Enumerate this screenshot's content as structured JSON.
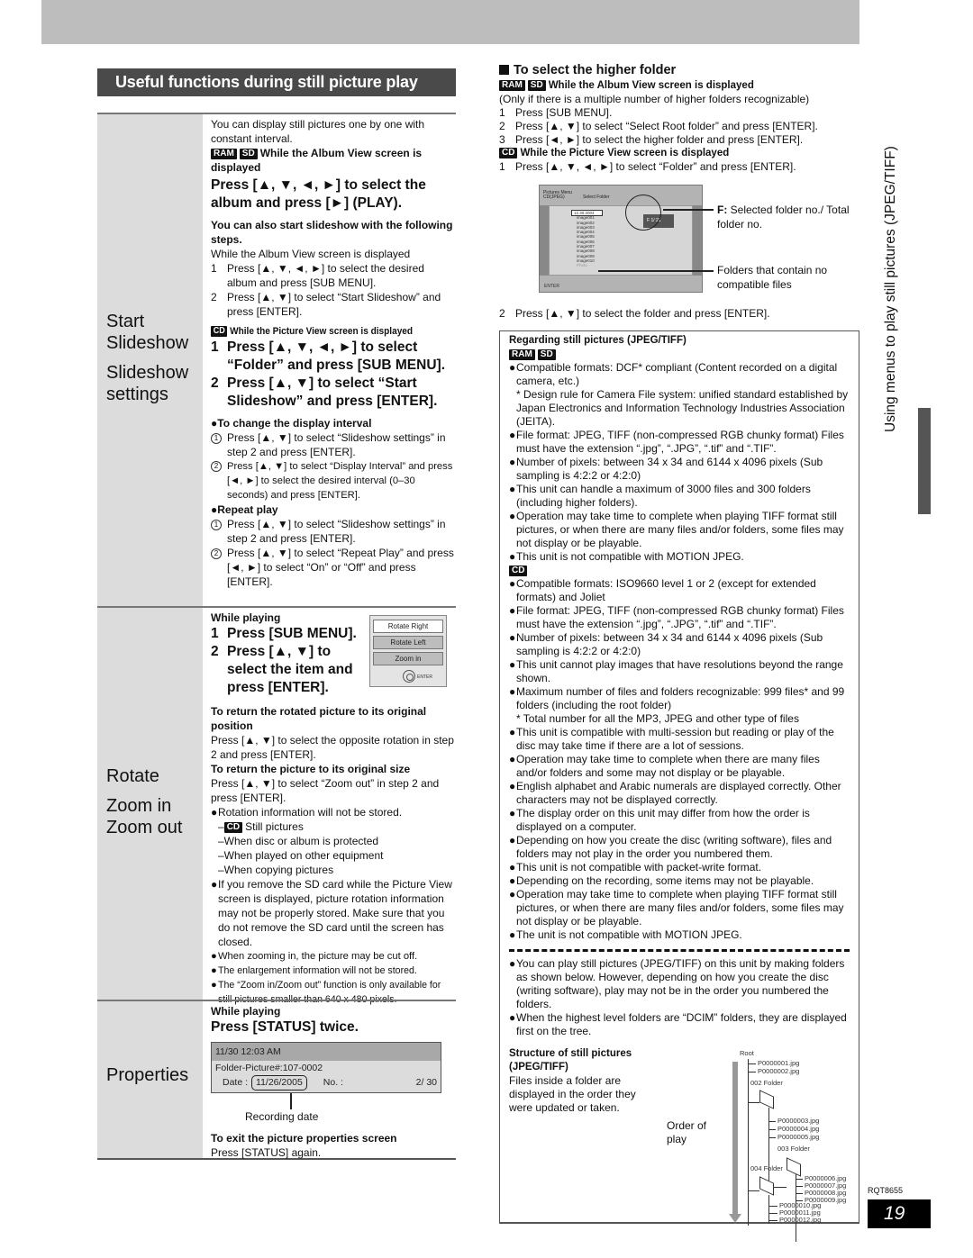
{
  "page": {
    "model_code": "RQT8655",
    "page_number": "19",
    "side_tab": "Using menus to play still pictures (JPEG/TIFF)"
  },
  "section_title": "Useful functions during still picture play",
  "badges": {
    "ram": "RAM",
    "sd": "SD",
    "cd": "CD"
  },
  "slideshow": {
    "labels": [
      "Start",
      "Slideshow",
      "Slideshow",
      "settings"
    ],
    "intro": "You can display still pictures one by one with constant interval.",
    "ramsd_cond": "While the Album View screen is displayed",
    "main_step": "Press [▲, ▼, ◄, ►] to select the album and press [►] (PLAY).",
    "also_title": "You can also start slideshow with the following steps.",
    "also_cond": "While the Album View screen is displayed",
    "also_steps": [
      "Press [▲, ▼, ◄, ►] to select the desired album and press [SUB MENU].",
      "Press [▲, ▼] to select “Start Slideshow” and press [ENTER]."
    ],
    "cd_cond": "While the Picture View screen is displayed",
    "cd_steps": [
      "Press [▲, ▼, ◄, ►] to select “Folder” and press [SUB MENU].",
      "Press [▲, ▼] to select “Start Slideshow” and press [ENTER]."
    ],
    "interval_title": "●To change the display interval",
    "interval_steps": [
      "Press [▲, ▼] to select “Slideshow settings” in step 2 and press [ENTER].",
      "Press [▲, ▼] to select “Display Interval” and press [◄, ►] to select the desired interval (0–30 seconds) and press [ENTER]."
    ],
    "repeat_title": "●Repeat play",
    "repeat_steps": [
      "Press [▲, ▼] to select “Slideshow settings” in step 2 and press [ENTER].",
      "Press [▲, ▼] to select “Repeat Play” and press [◄, ►] to select “On” or “Off” and press [ENTER]."
    ]
  },
  "rotate": {
    "labels": [
      "Rotate",
      "Zoom in",
      "Zoom out"
    ],
    "while_playing": "While playing",
    "steps": [
      "Press [SUB MENU].",
      "Press [▲, ▼] to select the item and press [ENTER]."
    ],
    "submenu": [
      "Rotate Right",
      "Rotate Left",
      "Zoom in"
    ],
    "submenu_enter": "ENTER",
    "return_rot_title": "To return the rotated picture to its original position",
    "return_rot_text": "Press [▲, ▼] to select the opposite rotation in step 2 and press [ENTER].",
    "return_size_title": "To return the picture to its original size",
    "return_size_text": "Press [▲, ▼] to select “Zoom out” in step 2 and press [ENTER].",
    "note_rotation": "Rotation information will not be stored.",
    "note_cd_still": "Still pictures",
    "note_dashes": [
      "–When disc or album is protected",
      "–When played on other equipment",
      "–When copying pictures"
    ],
    "note_sd": "If you remove the SD card while the Picture View screen is displayed, picture rotation information may not be properly stored. Make sure that you do not remove the SD card until the screen has closed.",
    "note_cut": "When zooming in, the picture may be cut off.",
    "note_enlarge": "The enlargement information will not be stored.",
    "note_zoom": "The “Zoom in/Zoom out” function is only available for still pictures smaller than 640 x 480 pixels."
  },
  "properties": {
    "label": "Properties",
    "while_playing": "While playing",
    "step": "Press [STATUS] twice.",
    "screen_top": "11/30  12:03 AM",
    "screen_folder": "Folder-Picture#:107-0002",
    "date_label": "Date :",
    "date_value": "11/26/2005",
    "no_label": "No. :",
    "no_value": "2/  30",
    "callout": "Recording date",
    "exit_title": "To exit the picture properties screen",
    "exit_text": "Press [STATUS] again."
  },
  "higher_folder": {
    "title": "To select the higher folder",
    "ramsd_cond": "While the Album View screen is displayed",
    "note": "(Only if there is a multiple number of higher folders recognizable)",
    "steps": [
      "Press [SUB MENU].",
      "Press [▲, ▼] to select “Select Root folder” and press [ENTER].",
      "Press [◄, ►] to select the higher folder and press [ENTER]."
    ],
    "cd_cond": "While the Picture View screen is displayed",
    "cd_step1": "Press [▲, ▼, ◄, ►] to select “Folder” and press [ENTER].",
    "cd_step2": "Press [▲, ▼] to select the folder and press [ENTER].",
    "screen": {
      "menu": "Pictures Menu",
      "sub": "CD(JPEG)",
      "title": "Select Folder",
      "counter": "F     1/ 21",
      "selected": "12.30.2004",
      "folders": [
        "image001",
        "image002",
        "image003",
        "image004",
        "image005",
        "image006",
        "image007",
        "image008",
        "image009",
        "image010",
        "Photo"
      ],
      "enter": "ENTER"
    },
    "annot_f_bold": "F:",
    "annot_f": " Selected folder no./ Total folder no.",
    "annot_nocompat": "Folders that contain no compatible files"
  },
  "regarding": {
    "title": "Regarding still pictures (JPEG/TIFF)",
    "ramsd_items": [
      "Compatible formats: DCF* compliant (Content recorded on a digital camera, etc.)",
      "File format: JPEG, TIFF (non-compressed RGB chunky format) Files must have the extension “.jpg”, “.JPG”, “.tif” and “.TIF”.",
      "Number of pixels: between 34 x 34 and 6144 x 4096 pixels (Sub sampling is 4:2:2 or 4:2:0)",
      "This unit can handle a maximum of 3000 files and 300 folders (including higher folders).",
      "Operation may take time to complete when playing TIFF format still pictures, or when there are many files and/or folders, some files may not display or be playable.",
      "This unit is not compatible with MOTION JPEG."
    ],
    "dcf_note": "* Design rule for Camera File system: unified standard established by Japan Electronics and Information Technology Industries Association (JEITA).",
    "cd_items": [
      "Compatible formats: ISO9660 level 1 or 2 (except for extended formats) and Joliet",
      "File format: JPEG, TIFF (non-compressed RGB chunky format) Files must have the extension “.jpg”, “.JPG”, “.tif” and “.TIF”.",
      "Number of pixels: between 34 x 34 and 6144 x 4096 pixels (Sub sampling is 4:2:2 or 4:2:0)",
      "This unit cannot play images that have resolutions beyond the range shown.",
      "Maximum number of files and folders recognizable: 999 files* and 99 folders (including the root folder)",
      "This unit is compatible with multi-session but reading or play of the disc may take time if there are a lot of sessions.",
      "Operation may take time to complete when there are many files and/or folders and some may not display or be playable.",
      "English alphabet and Arabic numerals are displayed correctly. Other characters may not be displayed correctly.",
      "The display order on this unit may differ from how the order is displayed on a computer.",
      "Depending on how you create the disc (writing software), files and folders may not play in the order you numbered them.",
      "This unit is not compatible with packet-write format.",
      "Depending on the recording, some items may not be playable.",
      "Operation may take time to complete when playing TIFF format still pictures, or when there are many files and/or folders, some files may not display or be playable.",
      "The unit is not compatible with MOTION JPEG."
    ],
    "cd_max_note": "* Total number for all the MP3, JPEG and other type of files",
    "after_items": [
      "You can play still pictures (JPEG/TIFF) on this unit by making folders as shown below. However, depending on how you create the disc (writing software), play may not be in the order you numbered the folders.",
      "When the highest level folders are “DCIM” folders, they are displayed first on the tree."
    ],
    "structure_title": "Structure of still pictures (JPEG/TIFF)",
    "structure_text": "Files inside a folder are displayed in the order they were updated or taken.",
    "order_label": "Order of play",
    "tree": {
      "root": "Root",
      "root_files": [
        "P0000001.jpg",
        "P0000002.jpg"
      ],
      "folder2": "002 Folder",
      "folder2_files": [
        "P0000003.jpg",
        "P0000004.jpg",
        "P0000005.jpg"
      ],
      "folder3": "003 Folder",
      "folder3_files": [
        "P0000006.jpg",
        "P0000007.jpg",
        "P0000008.jpg",
        "P0000009.jpg"
      ],
      "folder4": "004 Folder",
      "folder4_files": [
        "P0000010.jpg",
        "P0000011.jpg",
        "P0000012.jpg"
      ]
    }
  }
}
